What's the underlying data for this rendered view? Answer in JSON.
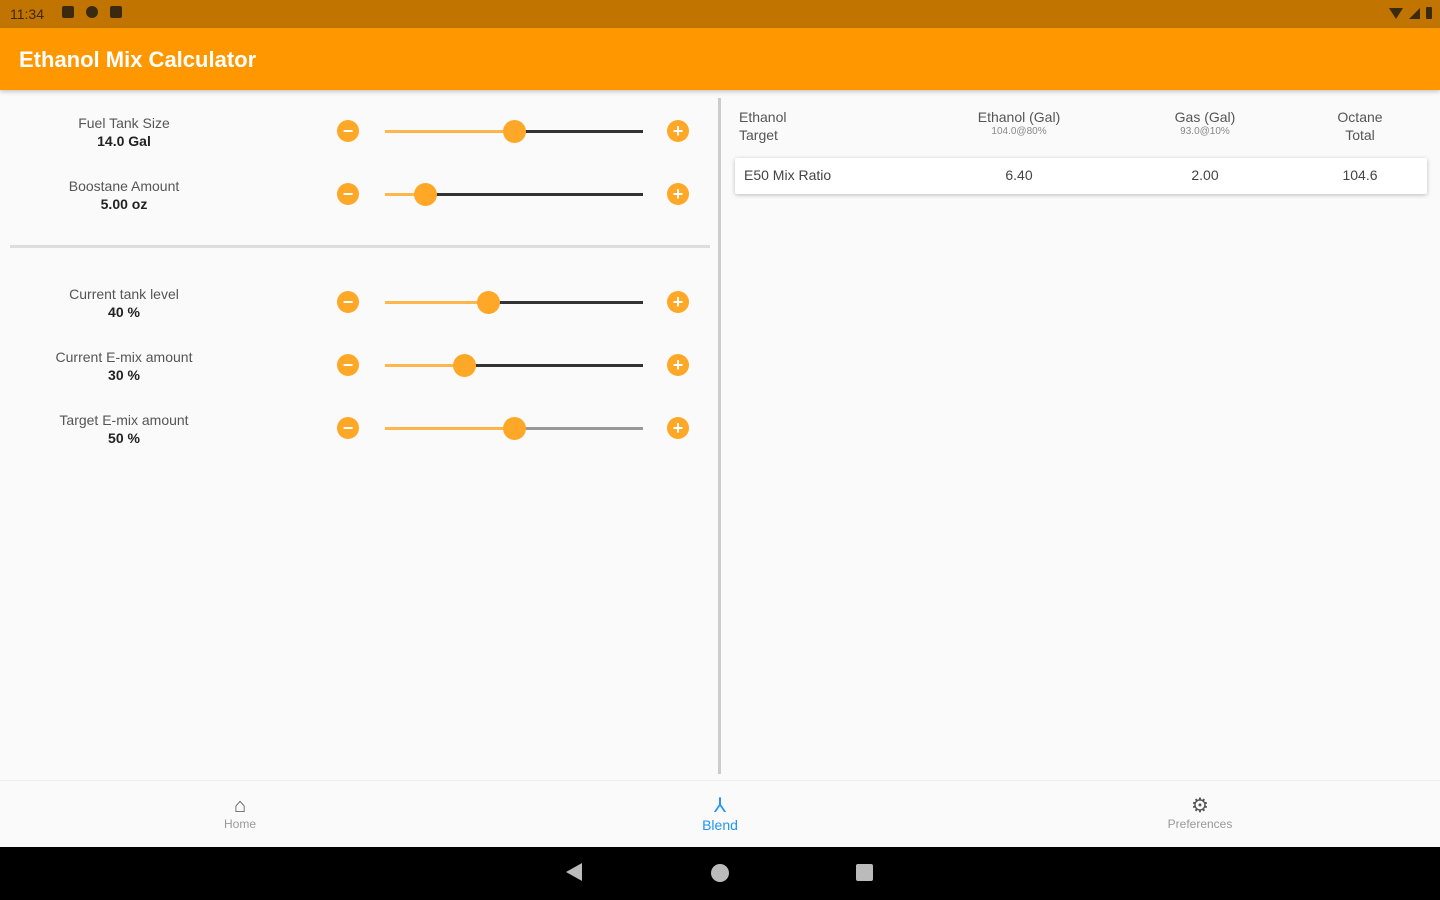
{
  "status_bar": {
    "time": "11:34"
  },
  "app_bar": {
    "title": "Ethanol Mix Calculator"
  },
  "sliders": [
    {
      "name": "Fuel Tank Size",
      "value": "14.0 Gal",
      "level": 0.5
    },
    {
      "name": "Boostane Amount",
      "value": "5.00 oz",
      "level": 0.155
    },
    {
      "name": "Current tank level",
      "value": "40 %",
      "level": 0.4
    },
    {
      "name": "Current E-mix amount",
      "value": "30 %",
      "level": 0.305
    },
    {
      "name": "Target E-mix amount",
      "value": "50 %",
      "level": 0.5
    }
  ],
  "table": {
    "headers": {
      "target_line1": "Ethanol",
      "target_line2": "Target",
      "ethanol": "Ethanol (Gal)",
      "ethanol_sub": "104.0@80%",
      "gas": "Gas (Gal)",
      "gas_sub": "93.0@10%",
      "octane_line1": "Octane",
      "octane_line2": "Total"
    },
    "row": {
      "label": "E50 Mix Ratio",
      "ethanol": "6.40",
      "gas": "2.00",
      "octane": "104.6"
    }
  },
  "bottom_nav": [
    {
      "label": "Home",
      "icon": "home-icon"
    },
    {
      "label": "Blend",
      "icon": "blend-icon",
      "active": true
    },
    {
      "label": "Preferences",
      "icon": "gear-icon"
    }
  ],
  "colors": {
    "accent": "#ff9800",
    "status_bar": "#c27400",
    "active_nav": "#2196f3"
  }
}
